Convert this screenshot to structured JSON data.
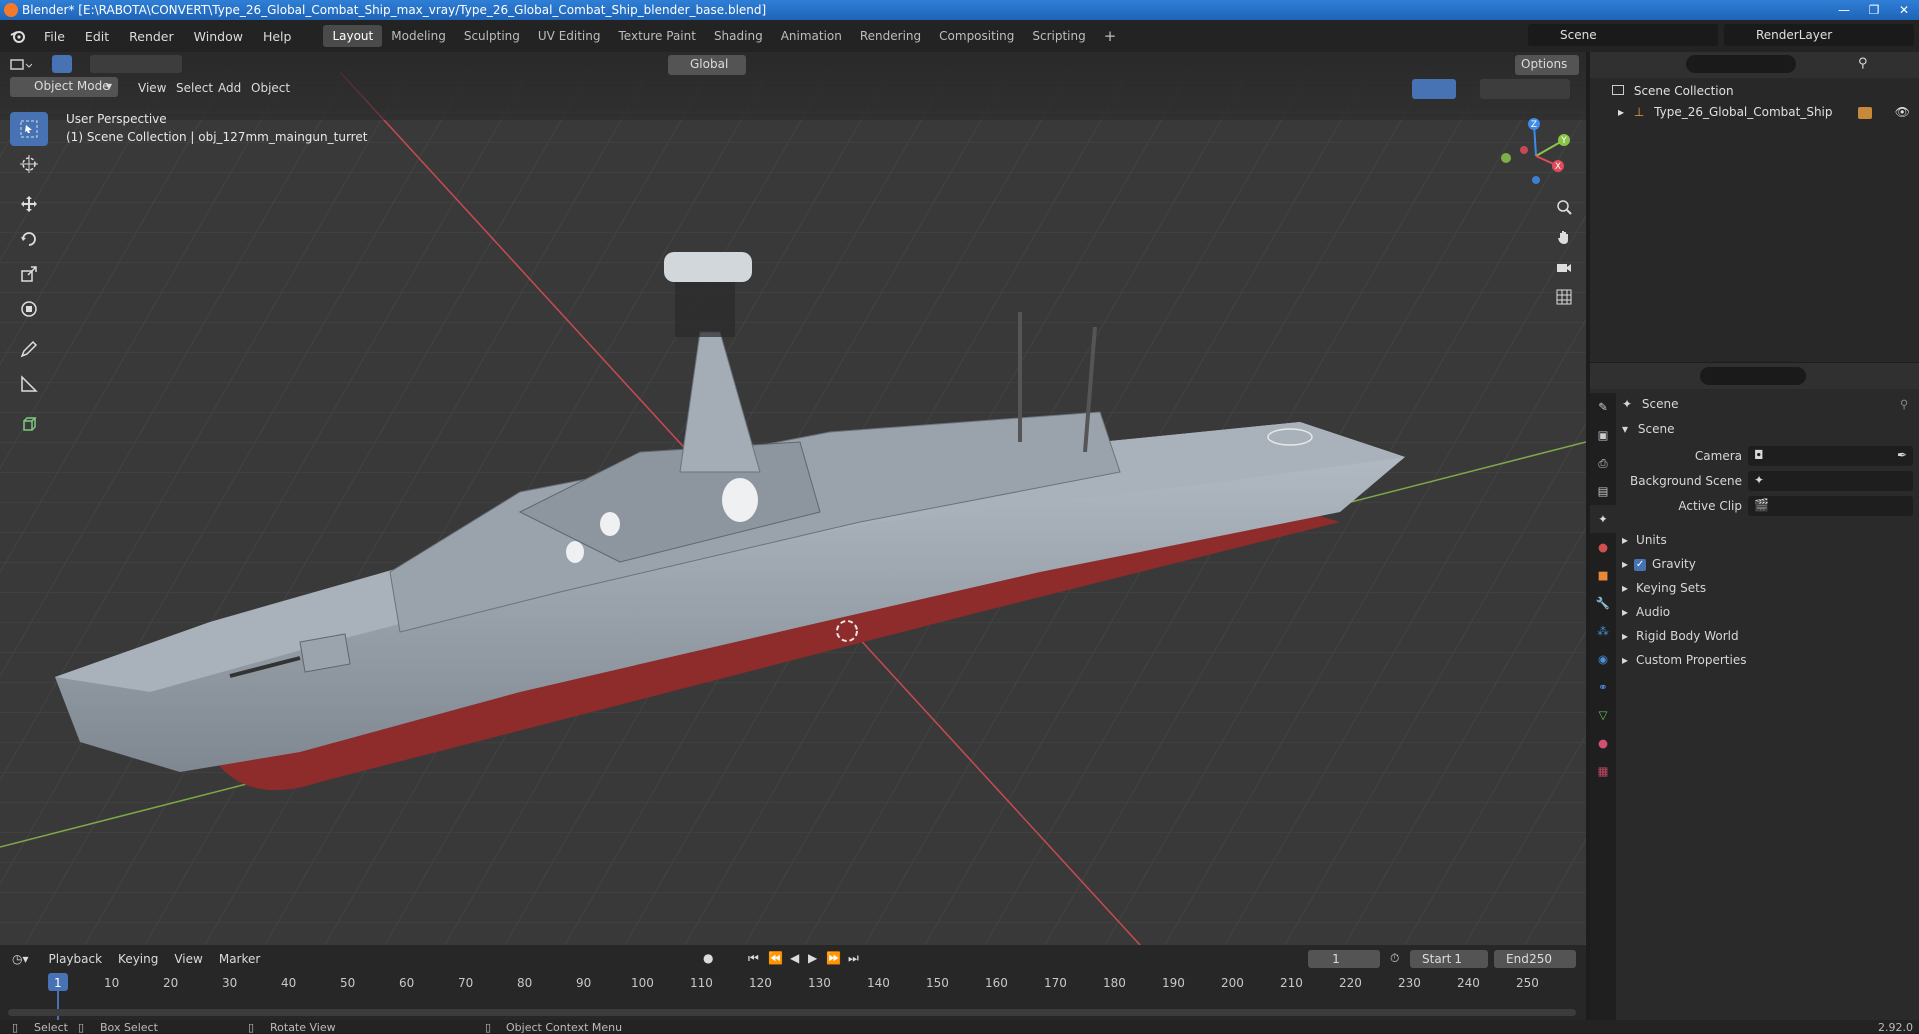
{
  "window": {
    "title": "Blender* [E:\\RABOTA\\CONVERT\\Type_26_Global_Combat_Ship_max_vray/Type_26_Global_Combat_Ship_blender_base.blend]",
    "controls": [
      "—",
      "❐",
      "✕"
    ]
  },
  "menu": [
    "File",
    "Edit",
    "Render",
    "Window",
    "Help"
  ],
  "workspaces": [
    {
      "label": "Layout",
      "active": true
    },
    {
      "label": "Modeling"
    },
    {
      "label": "Sculpting"
    },
    {
      "label": "UV Editing"
    },
    {
      "label": "Texture Paint"
    },
    {
      "label": "Shading"
    },
    {
      "label": "Animation"
    },
    {
      "label": "Rendering"
    },
    {
      "label": "Compositing"
    },
    {
      "label": "Scripting"
    }
  ],
  "scene_selector": "Scene",
  "view_layer": "RenderLayer",
  "viewport": {
    "mode": "Object Mode",
    "menus": [
      "View",
      "Select",
      "Add",
      "Object"
    ],
    "transform_orientation": "Global",
    "options_label": "Options",
    "perspective": "User Perspective",
    "context": "(1) Scene Collection | obj_127mm_maingun_turret",
    "gizmo_labels": {
      "z": "Z",
      "y": "Y",
      "x": "X"
    }
  },
  "outliner": {
    "root": "Scene Collection",
    "items": [
      {
        "label": "Type_26_Global_Combat_Ship"
      }
    ]
  },
  "properties": {
    "context_label": "Scene",
    "panel_title": "Scene",
    "fields": [
      {
        "label": "Camera"
      },
      {
        "label": "Background Scene"
      },
      {
        "label": "Active Clip"
      }
    ],
    "sections": [
      {
        "label": "Units"
      },
      {
        "label": "Gravity",
        "checked": true
      },
      {
        "label": "Keying Sets"
      },
      {
        "label": "Audio"
      },
      {
        "label": "Rigid Body World"
      },
      {
        "label": "Custom Properties"
      }
    ]
  },
  "timeline": {
    "menus": [
      "Playback",
      "Keying",
      "View",
      "Marker"
    ],
    "current_frame": "1",
    "start_label": "Start",
    "start": "1",
    "end_label": "End",
    "end": "250",
    "ruler": [
      "1",
      "10",
      "20",
      "30",
      "40",
      "50",
      "60",
      "70",
      "80",
      "90",
      "100",
      "110",
      "120",
      "130",
      "140",
      "150",
      "160",
      "170",
      "180",
      "190",
      "200",
      "210",
      "220",
      "230",
      "240",
      "250"
    ]
  },
  "statusbar": {
    "select": "Select",
    "box_select": "Box Select",
    "rotate_view": "Rotate View",
    "context_menu": "Object Context Menu",
    "version": "2.92.0"
  },
  "colors": {
    "accent": "#4772b3",
    "x_axis": "#e04a5a",
    "y_axis": "#8bc34a",
    "z_axis": "#3f8ce8",
    "hull_red": "#8e2b2b",
    "ship_gray": "#9aa2ab"
  }
}
